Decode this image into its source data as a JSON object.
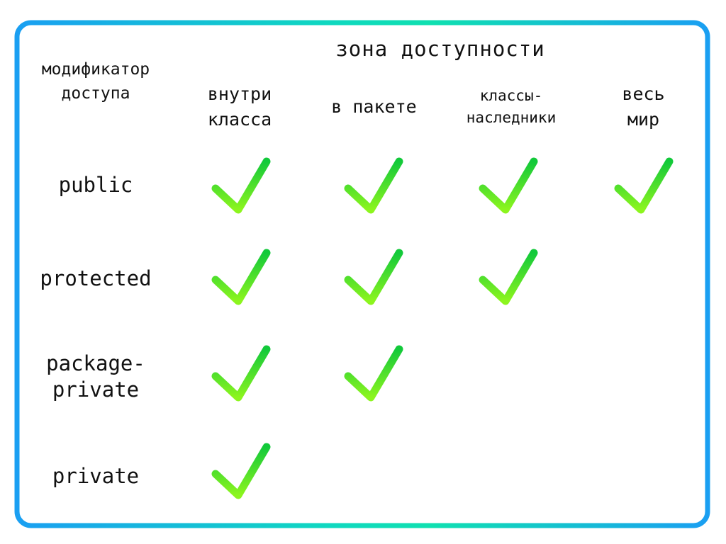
{
  "table": {
    "corner_header": "модификатор\nдоступа",
    "group_header": "зона доступности",
    "columns": [
      {
        "label": "внутри\nкласса"
      },
      {
        "label": "в пакете"
      },
      {
        "label": "классы-\nнаследники"
      },
      {
        "label": "весь\nмир"
      }
    ],
    "rows": [
      {
        "label": "public",
        "access": [
          true,
          true,
          true,
          true
        ]
      },
      {
        "label": "protected",
        "access": [
          true,
          true,
          true,
          false
        ]
      },
      {
        "label": "package-\nprivate",
        "access": [
          true,
          true,
          false,
          false
        ]
      },
      {
        "label": "private",
        "access": [
          true,
          false,
          false,
          false
        ]
      }
    ],
    "mark_icon": "checkmark-icon"
  },
  "colors": {
    "frame_blue": "#1aa0f0",
    "frame_teal": "#0fe0b0",
    "check_top": "#12c93a",
    "check_bottom": "#8cf51e",
    "text": "#111111"
  }
}
